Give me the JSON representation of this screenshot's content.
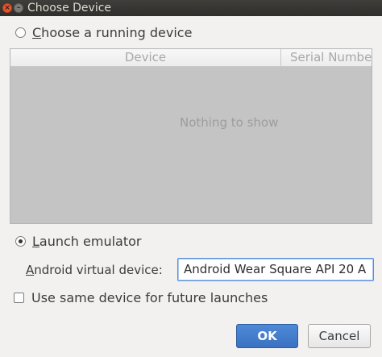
{
  "window": {
    "title": "Choose Device"
  },
  "running": {
    "mnemonic": "C",
    "label_rest": "hoose a running device",
    "selected": false
  },
  "table": {
    "columns": [
      "Device",
      "Serial Numbe"
    ],
    "empty_text": "Nothing to show"
  },
  "emulator": {
    "mnemonic": "L",
    "label_rest": "aunch emulator",
    "selected": true
  },
  "avd": {
    "mnemonic": "A",
    "label_rest": "ndroid virtual device:",
    "value": "Android Wear Square API 20 A"
  },
  "reuse": {
    "label": "Use same device for future launches",
    "checked": false
  },
  "buttons": {
    "ok": "OK",
    "cancel": "Cancel"
  },
  "icons": {
    "close": "close-icon",
    "minimize": "minimize-icon"
  },
  "colors": {
    "accent": "#3a72c0",
    "titlebar": "#2f2e2c",
    "background": "#f2f1f0"
  }
}
